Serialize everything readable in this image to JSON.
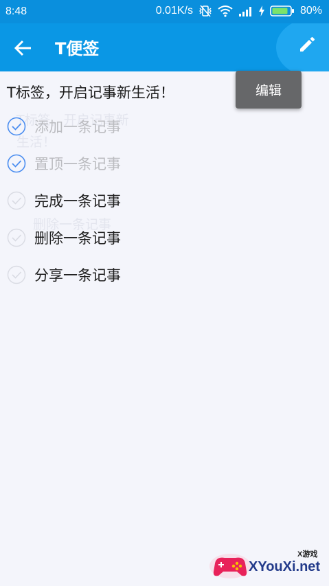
{
  "status_bar": {
    "time": "8:48",
    "net_speed": "0.01K/s",
    "battery_percent": "80%",
    "icons": [
      "vibrate-off-icon",
      "wifi-icon",
      "signal-icon",
      "charging-icon",
      "battery-icon"
    ]
  },
  "app_bar": {
    "title": "T便签",
    "back_icon": "arrow-left-icon",
    "edit_icon": "pencil-icon",
    "primary_color": "#0a97e5",
    "fab_color": "#1fa7f0"
  },
  "tooltip": {
    "label": "编辑"
  },
  "content": {
    "headline": "T标签，开启记事新生活！",
    "ghost_lines": [
      "T标签，开启记事新",
      "生活！",
      "删除一条记事"
    ],
    "tasks": [
      {
        "label": "添加一条记事",
        "done": true
      },
      {
        "label": "置顶一条记事",
        "done": true
      },
      {
        "label": "完成一条记事",
        "done": false
      },
      {
        "label": "删除一条记事",
        "done": false
      },
      {
        "label": "分享一条记事",
        "done": false
      }
    ],
    "check_color_done": "#4a8df0",
    "check_color_todo": "#d9dbe3"
  },
  "watermark": {
    "small_text": "X游戏",
    "site_text": "XYouXi.net"
  }
}
